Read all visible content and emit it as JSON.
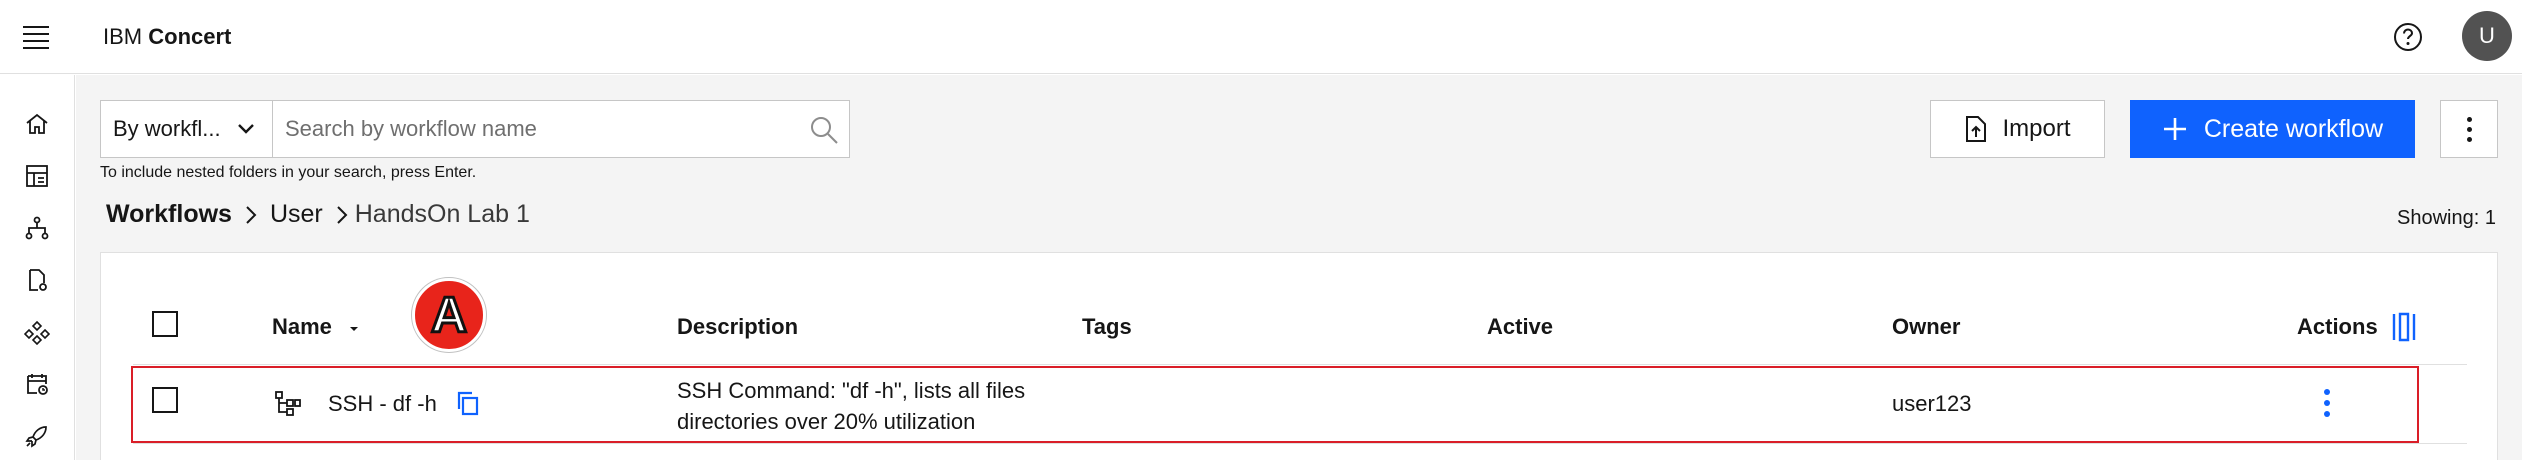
{
  "header": {
    "brand_prefix": "IBM",
    "brand_name": "Concert",
    "avatar_initial": "U"
  },
  "rail": {
    "icons": [
      "home-icon",
      "dashboard-icon",
      "hierarchy-icon",
      "document-settings-icon",
      "network-icon",
      "calendar-settings-icon",
      "rocket-icon"
    ]
  },
  "toolbar": {
    "filter_select": "By workfl...",
    "search_placeholder": "Search by workflow name",
    "hint": "To include nested folders in your search, press Enter.",
    "import_label": "Import",
    "create_label": "Create workflow"
  },
  "breadcrumb": {
    "root": "Workflows",
    "level1": "User",
    "current": "HandsOn Lab 1"
  },
  "showing": "Showing: 1",
  "table": {
    "columns": {
      "name": "Name",
      "description": "Description",
      "tags": "Tags",
      "active": "Active",
      "owner": "Owner",
      "actions": "Actions"
    },
    "rows": [
      {
        "name": "SSH - df -h",
        "description_line1": "SSH Command: \"df -h\", lists all files",
        "description_line2": "directories over 20% utilization",
        "tags": "",
        "active": "",
        "owner": "user123"
      }
    ]
  },
  "annotation": {
    "label": "A",
    "color": "#e8241b"
  },
  "colors": {
    "primary": "#0f62fe",
    "highlight": "#da1e28"
  }
}
